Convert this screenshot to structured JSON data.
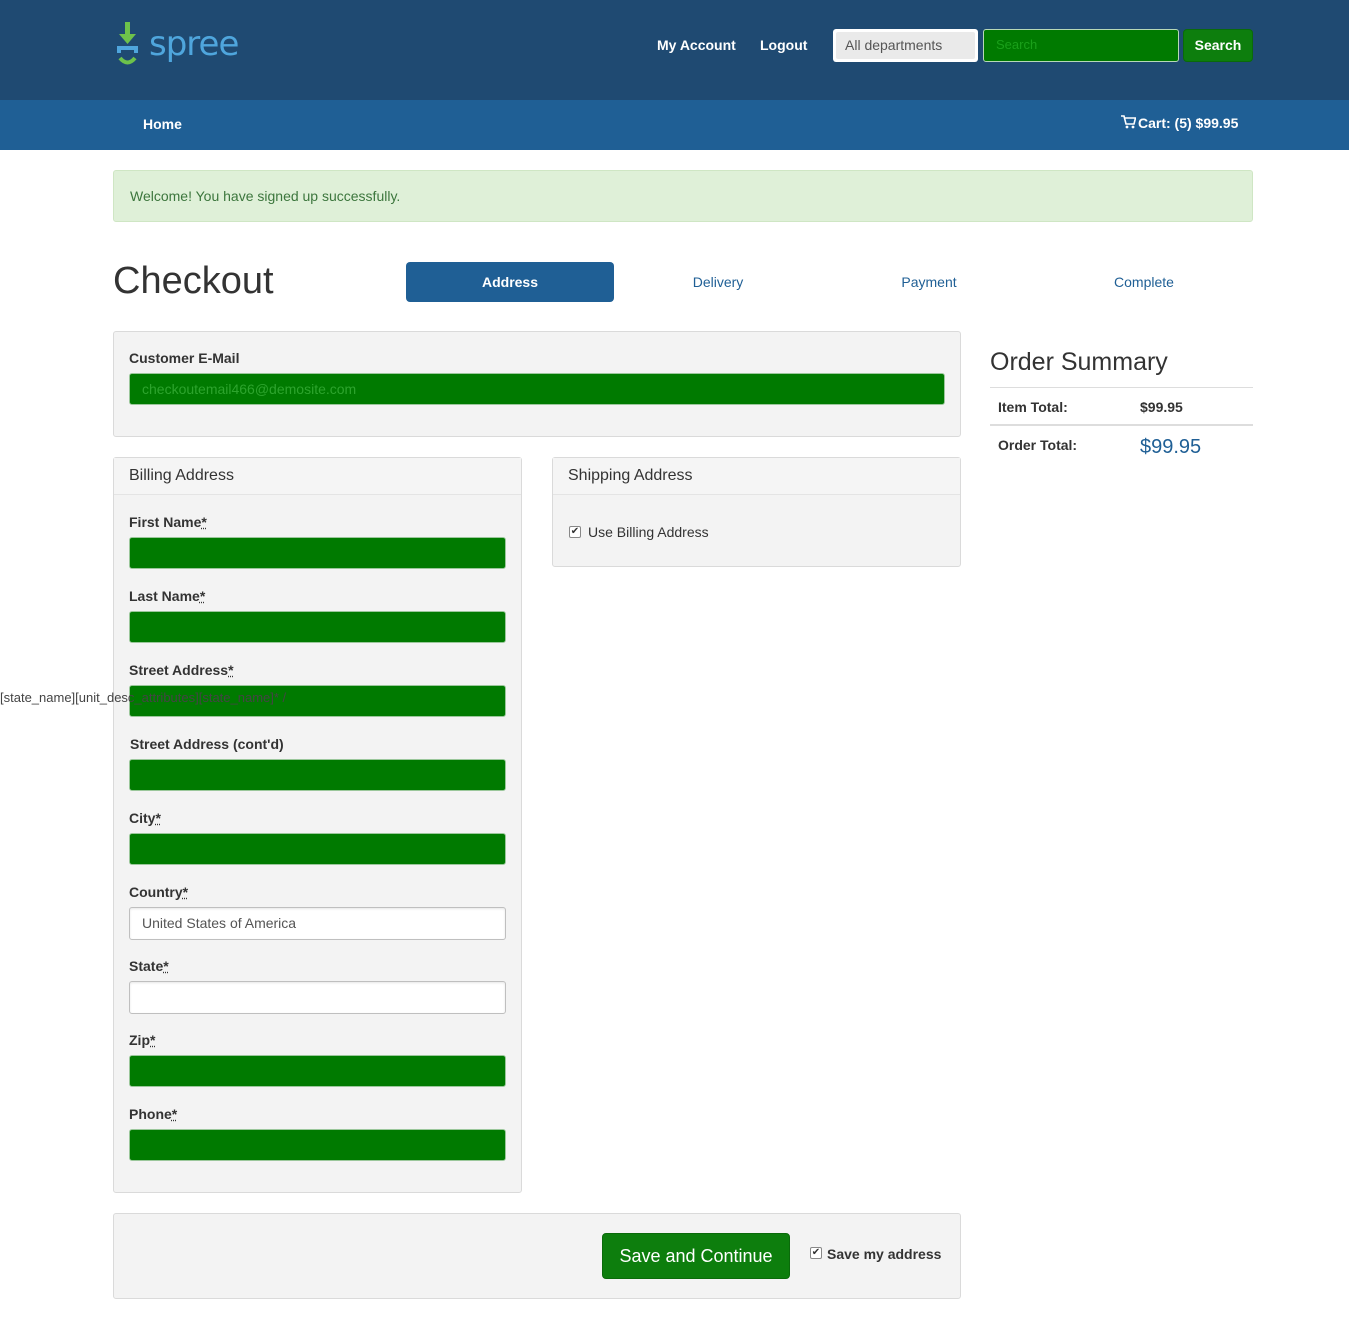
{
  "header": {
    "logo_text": "spree",
    "my_account": "My Account",
    "logout": "Logout",
    "department_select": "All departments",
    "search_placeholder": "Search",
    "search_button": "Search"
  },
  "nav": {
    "home": "Home",
    "cart": "Cart: (5) $99.95"
  },
  "alert": "Welcome! You have signed up successfully.",
  "checkout": {
    "title": "Checkout",
    "steps": [
      "Address",
      "Delivery",
      "Payment",
      "Complete"
    ],
    "active_step": "Address"
  },
  "email": {
    "label": "Customer E-Mail",
    "value": "checkoutemail466@demosite.com"
  },
  "billing": {
    "heading": "Billing Address",
    "first_name": "First Name",
    "last_name": "Last Name",
    "street": "Street Address",
    "street2": "Street Address (cont'd)",
    "city": "City",
    "country": "Country",
    "country_value": "United States of America",
    "state": "State",
    "zip": "Zip",
    "phone": "Phone",
    "required_mark": "*",
    "overlap_text": "[state_name][unit_desc_attributes][state_name]* /"
  },
  "shipping": {
    "heading": "Shipping Address",
    "use_billing": "Use Billing Address"
  },
  "summary": {
    "title": "Order Summary",
    "item_total_label": "Item Total:",
    "item_total_value": "$99.95",
    "order_total_label": "Order Total:",
    "order_total_value": "$99.95"
  },
  "footer": {
    "save_button": "Save and Continue",
    "save_address": "Save my address"
  },
  "colors": {
    "header_bg": "#1f4a72",
    "nav_bg": "#1f5f95",
    "input_green": "#007a00",
    "button_green": "#0d7e0d"
  }
}
